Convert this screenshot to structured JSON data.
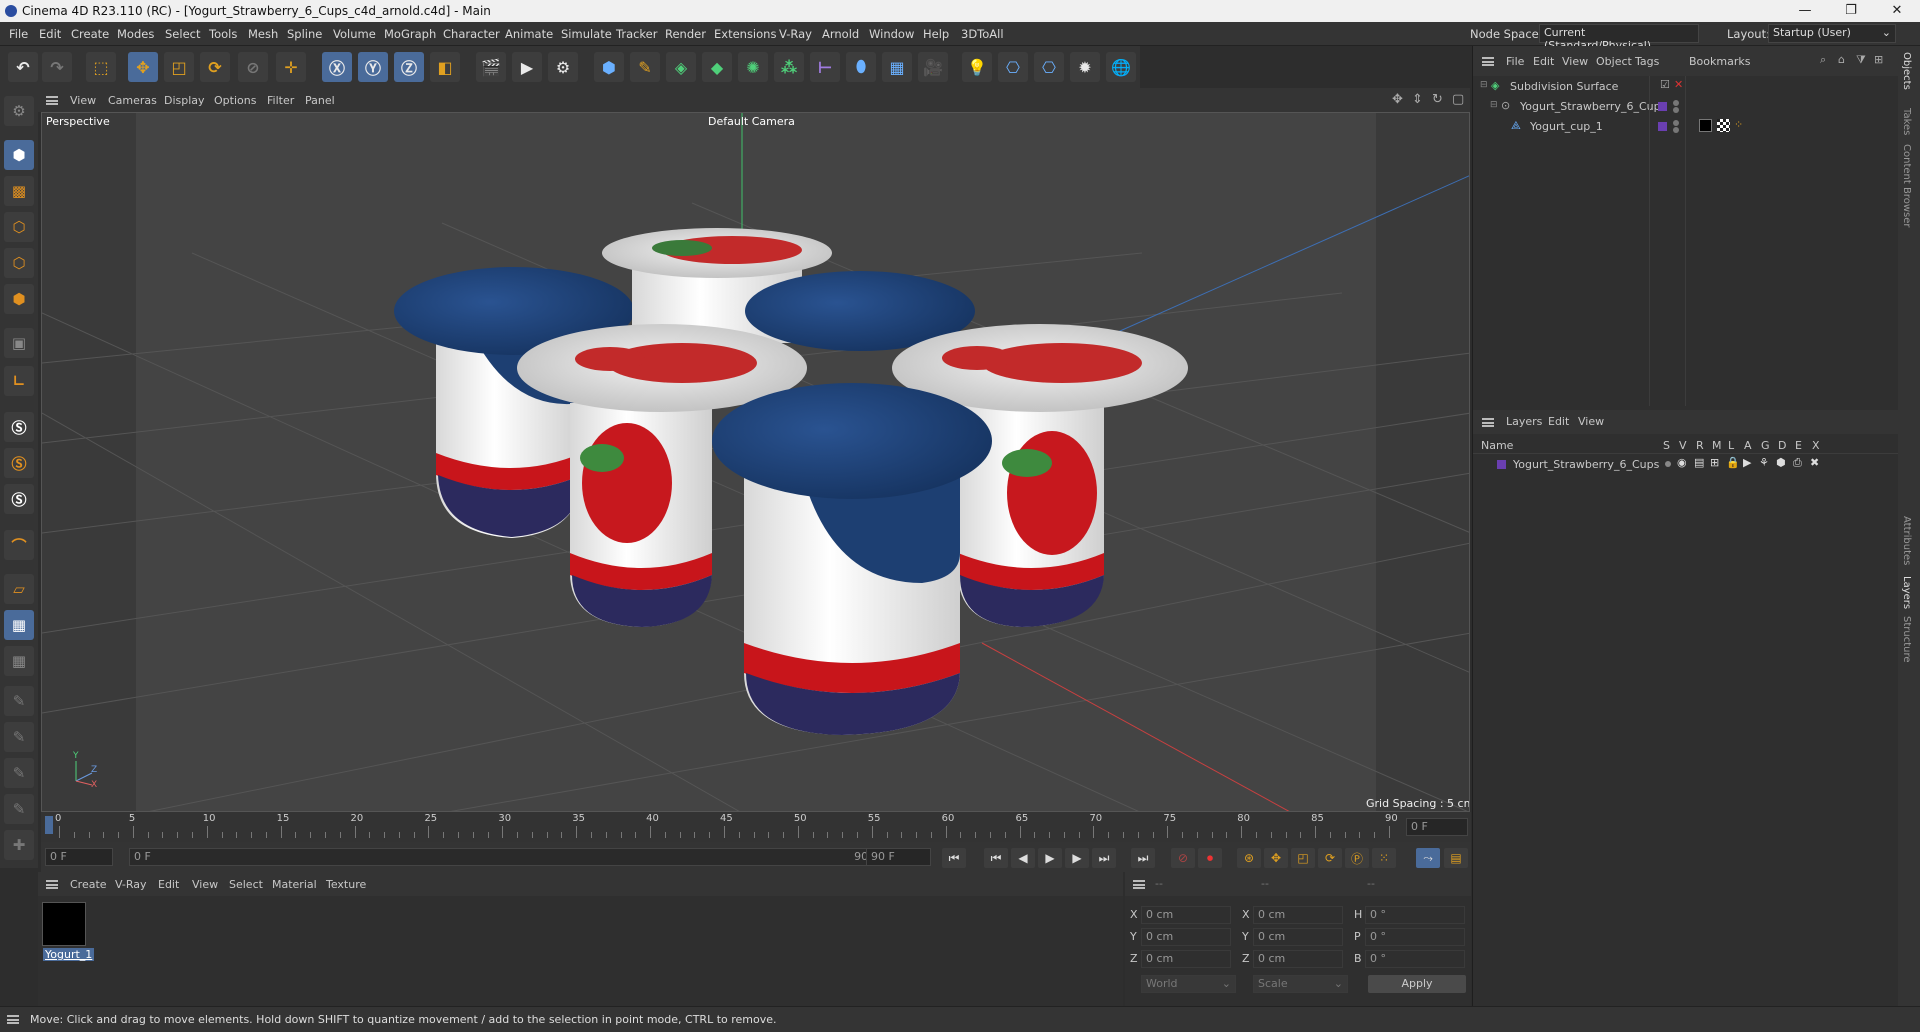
{
  "window": {
    "title": "Cinema 4D R23.110 (RC) - [Yogurt_Strawberry_6_Cups_c4d_arnold.c4d] - Main",
    "min": "—",
    "max": "❐",
    "close": "✕"
  },
  "menu": [
    "File",
    "Edit",
    "Create",
    "Modes",
    "Select",
    "Tools",
    "Mesh",
    "Spline",
    "Volume",
    "MoGraph",
    "Character",
    "Animate",
    "Simulate",
    "Tracker",
    "Render",
    "Extensions",
    "V-Ray",
    "Arnold",
    "Window",
    "Help",
    "3DToAll"
  ],
  "nodespace": {
    "label": "Node Space:",
    "value": "Current (Standard/Physical)",
    "layout_label": "Layout:",
    "layout_value": "Startup (User)"
  },
  "viewport": {
    "menu": [
      "View",
      "Cameras",
      "Display",
      "Options",
      "Filter",
      "Panel"
    ],
    "name": "Perspective",
    "camera": "Default Camera",
    "grid": "Grid Spacing : 5 cm",
    "axis_y": "Y",
    "axis_z": "Z",
    "axis_x": "X"
  },
  "objects": {
    "menu": [
      "File",
      "Edit",
      "View",
      "Object",
      "Tags",
      "Bookmarks"
    ],
    "items": [
      {
        "name": "Subdivision Surface"
      },
      {
        "name": "Yogurt_Strawberry_6_Cups"
      },
      {
        "name": "Yogurt_cup_1"
      }
    ]
  },
  "layers": {
    "menu": [
      "Layers",
      "Edit",
      "View"
    ],
    "header_name": "Name",
    "cols": [
      "S",
      "V",
      "R",
      "M",
      "L",
      "A",
      "G",
      "D",
      "E",
      "X"
    ],
    "item": "Yogurt_Strawberry_6_Cups"
  },
  "sidetabs": [
    "Objects",
    "Takes",
    "Content Browser",
    "Attributes",
    "Layers",
    "Structure"
  ],
  "timeline": {
    "ticks": [
      "0",
      "5",
      "10",
      "15",
      "20",
      "25",
      "30",
      "35",
      "40",
      "45",
      "50",
      "55",
      "60",
      "65",
      "70",
      "75",
      "80",
      "85",
      "90"
    ],
    "frame_field": "0 F"
  },
  "transport": {
    "start": "0 F",
    "range_start": "0 F",
    "range_end": "90 F",
    "end": "90 F"
  },
  "materials": {
    "menu": [
      "Create",
      "V-Ray",
      "Edit",
      "View",
      "Select",
      "Material",
      "Texture"
    ],
    "item": "Yogurt_1"
  },
  "coords": {
    "h1": "--",
    "h2": "--",
    "h3": "--",
    "x": "0 cm",
    "y": "0 cm",
    "z": "0 cm",
    "sx": "0 cm",
    "sy": "0 cm",
    "sz": "0 cm",
    "h": "0 °",
    "p": "0 °",
    "b": "0 °",
    "lx": "X",
    "ly": "Y",
    "lz": "Z",
    "lh": "H",
    "lp": "P",
    "lb": "B",
    "world": "World",
    "scale": "Scale",
    "apply": "Apply"
  },
  "status": "Move: Click and drag to move elements. Hold down SHIFT to quantize movement / add to the selection in point mode, CTRL to remove.",
  "colors": {
    "accent": "#4a6b9a",
    "lid": "#1d3f72",
    "red": "#c8151b"
  }
}
